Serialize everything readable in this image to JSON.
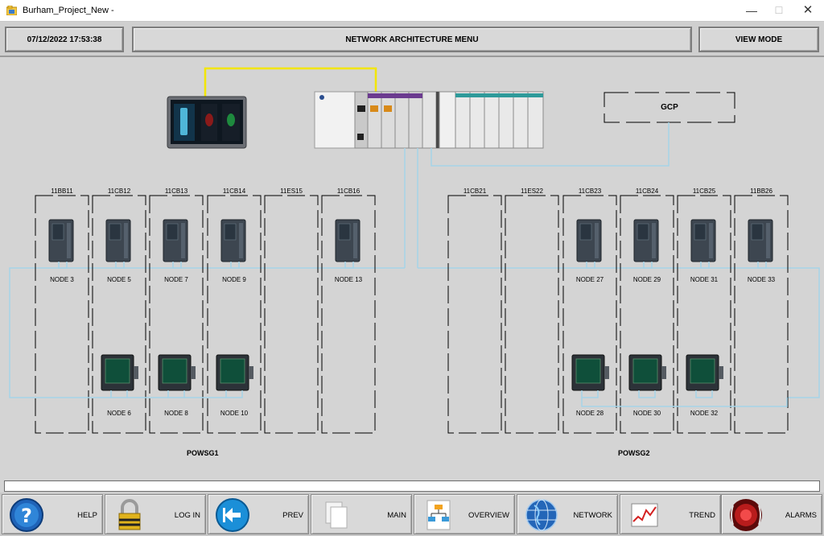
{
  "window": {
    "title": "Burham_Project_New -"
  },
  "header": {
    "datetime": "07/12/2022 17:53:38",
    "menu_title": "NETWORK  ARCHITECTURE  MENU",
    "mode": "VIEW MODE"
  },
  "diagram": {
    "gcp_label": "GCP",
    "group1": "POWSG1",
    "group2": "POWSG2",
    "panels": [
      "11BB11",
      "11CB12",
      "11CB13",
      "11CB14",
      "11ES15",
      "11CB16",
      "11CB21",
      "11ES22",
      "11CB23",
      "11CB24",
      "11CB25",
      "11BB26"
    ],
    "relay_nodes": [
      "NODE 3",
      "NODE 5",
      "NODE 7",
      "NODE 9",
      "NODE 13",
      "NODE 27",
      "NODE 29",
      "NODE 31",
      "NODE 33"
    ],
    "meter_nodes": [
      "NODE 6",
      "NODE 8",
      "NODE 10",
      "NODE 28",
      "NODE 30",
      "NODE 32"
    ],
    "colors": {
      "ethernet": "#a5d4e8",
      "hmi_link": "#f2e600",
      "panel_border": "#000000"
    }
  },
  "footer": {
    "buttons": [
      {
        "label": "HELP",
        "icon": "help-icon"
      },
      {
        "label": "LOG IN",
        "icon": "padlock-icon"
      },
      {
        "label": "PREV",
        "icon": "prev-arrow-icon"
      },
      {
        "label": "MAIN",
        "icon": "documents-icon"
      },
      {
        "label": "OVERVIEW",
        "icon": "overview-icon"
      },
      {
        "label": "NETWORK",
        "icon": "globe-icon"
      },
      {
        "label": "TREND",
        "icon": "trend-icon"
      },
      {
        "label": "ALARMS",
        "icon": "alarm-icon"
      }
    ]
  }
}
